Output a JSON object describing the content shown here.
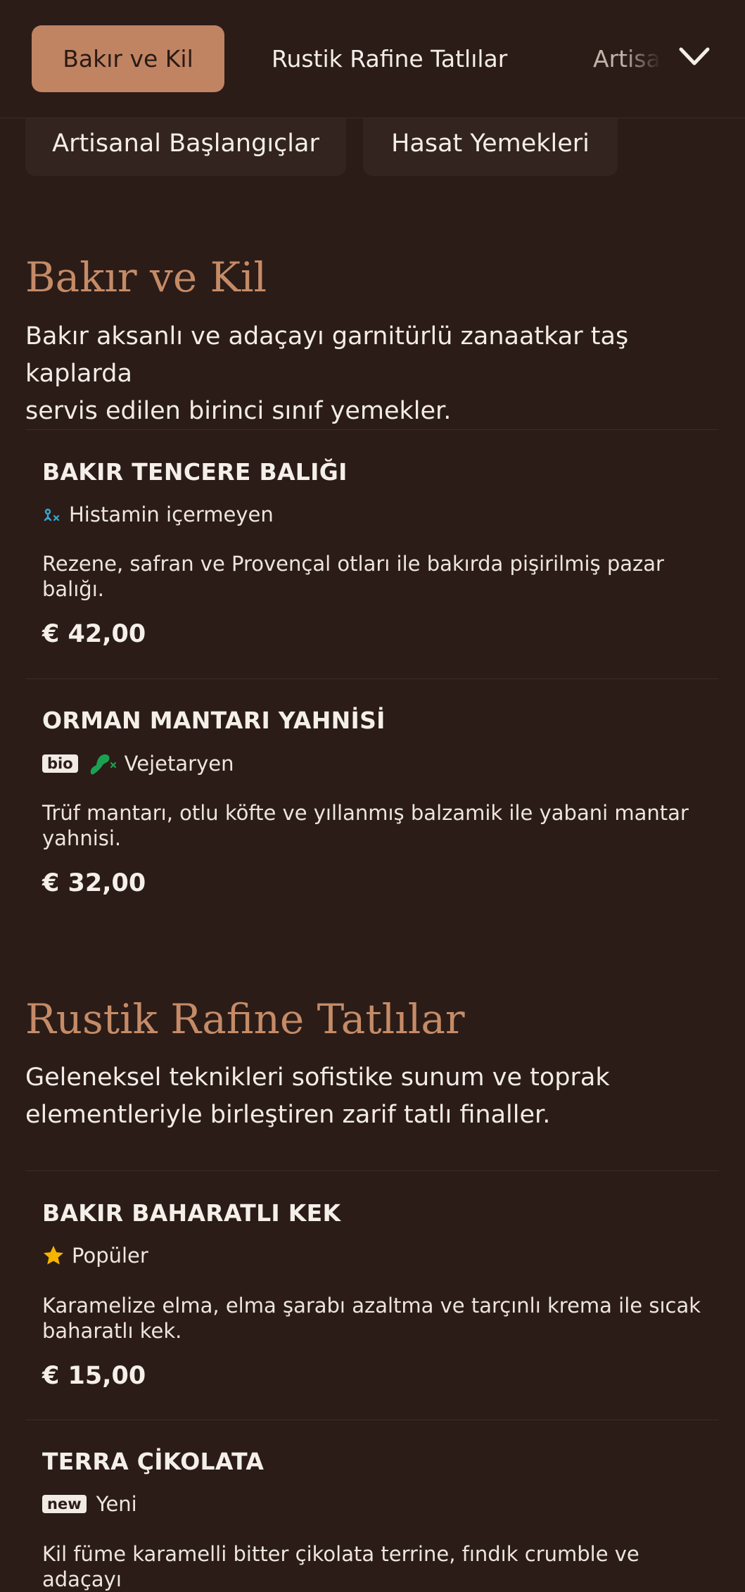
{
  "nav": {
    "tabs": [
      {
        "label": "Bakır ve Kil",
        "active": true
      },
      {
        "label": "Rustik Rafine Tatlılar"
      },
      {
        "label": "Artisanal Başlangıçlar"
      }
    ],
    "expand_icon": "chevron-down-icon",
    "pills": [
      {
        "label": "Artisanal Başlangıçlar"
      },
      {
        "label": "Hasat Yemekleri"
      }
    ]
  },
  "sections": [
    {
      "title": "Bakır ve Kil",
      "desc_line1": "Bakır aksanlı ve adaçayı garnitürlü zanaatkar taş kaplarda",
      "desc_line2": "servis edilen birinci sınıf yemekler.",
      "items": [
        {
          "name": "BAKIR TENCERE BALIĞI",
          "tag": "Histamin içermeyen",
          "tag_icon": "histamine-free-icon",
          "desc_line1": "Rezene, safran ve Provençal otları ile bakırda pişirilmiş pazar",
          "desc_line2": "balığı.",
          "price": "€ 42,00"
        },
        {
          "name": "ORMAN MANTARI YAHNİSİ",
          "badge": "bio",
          "tag": "Vejetaryen",
          "tag_icon": "vegetarian-icon",
          "desc_line1": "Trüf mantarı, otlu köfte ve yıllanmış balzamik ile yabani mantar",
          "desc_line2": "yahnisi.",
          "price": "€ 32,00"
        }
      ]
    },
    {
      "title": "Rustik Rafine Tatlılar",
      "desc_line1": "Geleneksel teknikleri sofistike sunum ve toprak",
      "desc_line2": "elementleriyle birleştiren zarif tatlı finaller.",
      "items": [
        {
          "name": "BAKIR BAHARATLI KEK",
          "tag": "Popüler",
          "tag_icon": "star-icon",
          "desc_line1": "Karamelize elma, elma şarabı azaltma ve tarçınlı krema ile sıcak",
          "desc_line2": "baharatlı kek.",
          "price": "€ 15,00"
        },
        {
          "name": "TERRA ÇİKOLATA",
          "badge": "new",
          "tag": "Yeni",
          "desc_line1": "Kil füme karamelli bitter çikolata terrine, fındık crumble ve adaçayı"
        }
      ]
    }
  ],
  "colors": {
    "background": "#2b1c17",
    "accent": "#c08463",
    "heading": "#c58b67",
    "star": "#f4b400",
    "veg": "#1aa251"
  }
}
